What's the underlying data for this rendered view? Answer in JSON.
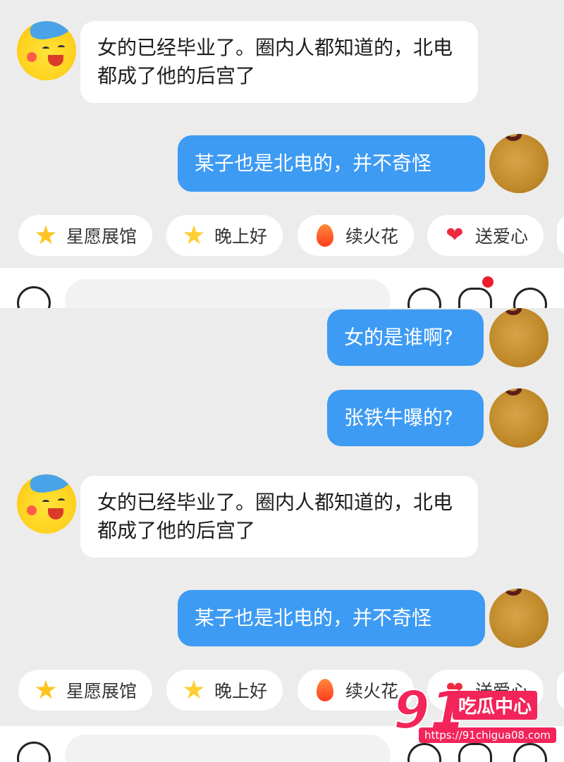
{
  "conversation_top": {
    "messages": [
      {
        "side": "in",
        "text": "女的已经毕业了。圈内人都知道的，北电都成了他的后宫了"
      },
      {
        "side": "out",
        "text": "某子也是北电的，并不奇怪"
      }
    ],
    "quick_replies": [
      "星愿展馆",
      "晚上好",
      "续火花",
      "送爱心"
    ]
  },
  "conversation_bottom": {
    "messages": [
      {
        "side": "out",
        "text": "女的是谁啊?"
      },
      {
        "side": "out",
        "text": "张铁牛曝的?"
      },
      {
        "side": "in",
        "text": "女的已经毕业了。圈内人都知道的，北电都成了他的后宫了"
      },
      {
        "side": "out",
        "text": "某子也是北电的，并不奇怪"
      }
    ],
    "quick_replies": [
      "星愿展馆",
      "晚上好",
      "续火花",
      "送爱心"
    ]
  },
  "icons": {
    "voice": "voice-icon",
    "emoji": "emoji-icon",
    "sticker": "sticker-icon",
    "plus": "plus-icon"
  },
  "watermark": {
    "number": "91",
    "brand": "吃瓜中心",
    "url": "https://91chigua08.com"
  },
  "colors": {
    "outgoing_bubble": "#3d9bf3",
    "incoming_bubble": "#ffffff",
    "background": "#ececec",
    "notification_dot": "#ee1b2e",
    "watermark": "#f2245a"
  }
}
